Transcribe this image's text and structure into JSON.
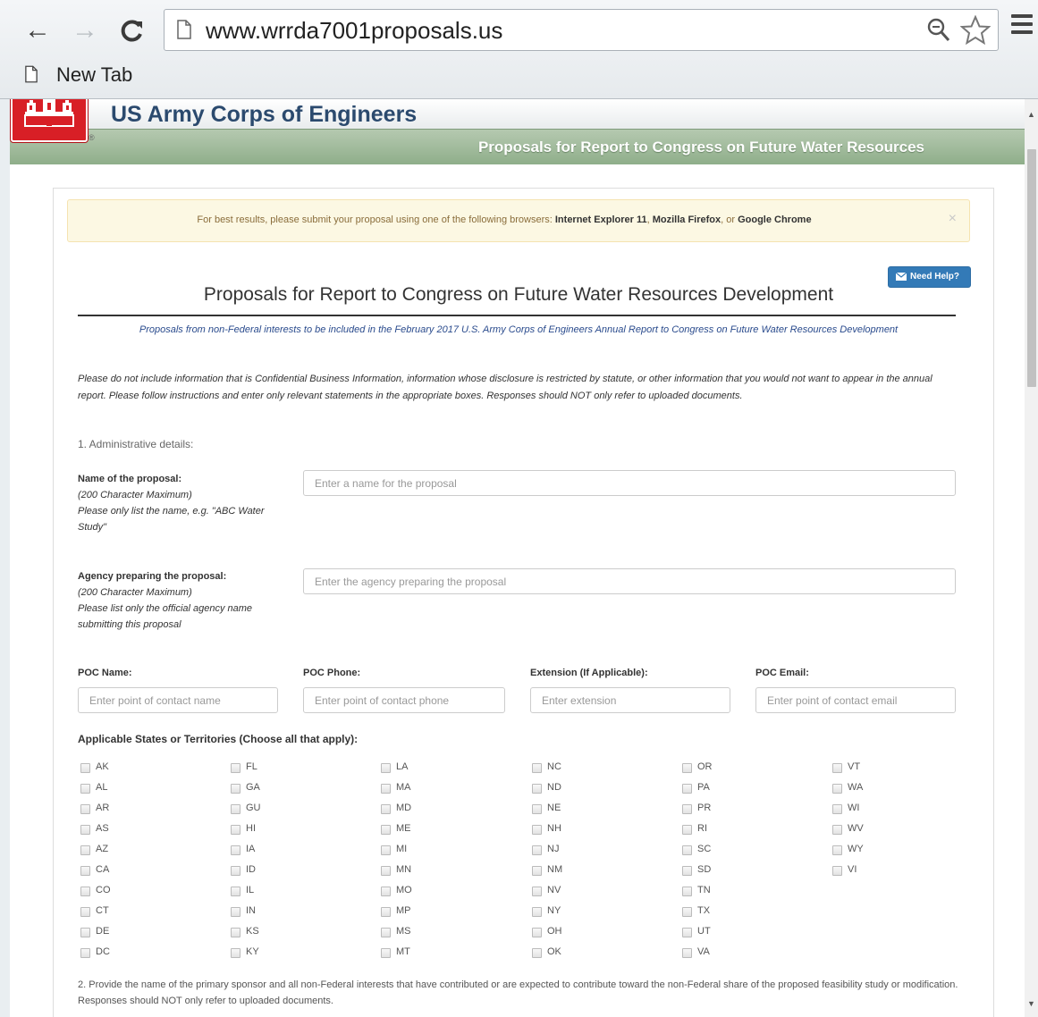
{
  "browser": {
    "url": "www.wrrda7001proposals.us",
    "tab_label": "New Tab",
    "back_glyph": "←",
    "forward_glyph": "→",
    "reload_glyph": "C"
  },
  "site": {
    "org_name": "US Army Corps of Engineers",
    "banner_title": "Proposals for Report to Congress on Future Water Resources",
    "registered_mark": "®"
  },
  "alert": {
    "prefix": "For best results, please submit your proposal using one of the following browsers: ",
    "browser1": "Internet Explorer 11",
    "sep1": ", ",
    "browser2": "Mozilla Firefox",
    "sep2": ", or ",
    "browser3": "Google Chrome",
    "close": "×"
  },
  "help_button": {
    "label": "Need Help?"
  },
  "form": {
    "title": "Proposals for Report to Congress on Future Water Resources Development",
    "subtitle": "Proposals from non-Federal interests to be included in the February 2017 U.S. Army Corps of Engineers Annual Report to Congress on Future Water Resources Development",
    "notice": "Please do not include information that is Confidential Business Information, information whose disclosure is restricted by statute, or other information that you would not want to appear in the annual report. Please follow instructions and enter only relevant statements in the appropriate boxes. Responses should NOT only refer to uploaded documents.",
    "section1": "1. Administrative details:",
    "name": {
      "label": "Name of the proposal:",
      "max": "(200 Character Maximum)",
      "hint": "Please only list the name, e.g. \"ABC Water Study\"",
      "placeholder": "Enter a name for the proposal"
    },
    "agency": {
      "label": "Agency preparing the proposal:",
      "max": "(200 Character Maximum)",
      "hint": "Please list only the official agency name submitting this proposal",
      "placeholder": "Enter the agency preparing the proposal"
    },
    "poc": {
      "name_label": "POC Name:",
      "name_placeholder": "Enter point of contact name",
      "phone_label": "POC Phone:",
      "phone_placeholder": "Enter point of contact phone",
      "ext_label": "Extension (If Applicable):",
      "ext_placeholder": "Enter extension",
      "email_label": "POC Email:",
      "email_placeholder": "Enter point of contact email"
    },
    "states_heading": "Applicable States or Territories (Choose all that apply):",
    "states": [
      [
        "AK",
        "AL",
        "AR",
        "AS",
        "AZ",
        "CA",
        "CO",
        "CT",
        "DE",
        "DC"
      ],
      [
        "FL",
        "GA",
        "GU",
        "HI",
        "IA",
        "ID",
        "IL",
        "IN",
        "KS",
        "KY"
      ],
      [
        "LA",
        "MA",
        "MD",
        "ME",
        "MI",
        "MN",
        "MO",
        "MP",
        "MS",
        "MT"
      ],
      [
        "NC",
        "ND",
        "NE",
        "NH",
        "NJ",
        "NM",
        "NV",
        "NY",
        "OH",
        "OK"
      ],
      [
        "OR",
        "PA",
        "PR",
        "RI",
        "SC",
        "SD",
        "TN",
        "TX",
        "UT",
        "VA"
      ],
      [
        "VT",
        "WA",
        "WI",
        "WV",
        "WY",
        "VI"
      ]
    ],
    "question2": "2. Provide the name of the primary sponsor and all non-Federal interests that have contributed or are expected to contribute toward the non-Federal share of the proposed feasibility study or modification. Responses should NOT only refer to uploaded documents."
  },
  "colors": {
    "header_text": "#2b4a6e",
    "banner_green": "#8fae8a",
    "alert_bg": "#fcf8e3",
    "help_blue": "#337ab7",
    "logo_red": "#d81f26"
  }
}
